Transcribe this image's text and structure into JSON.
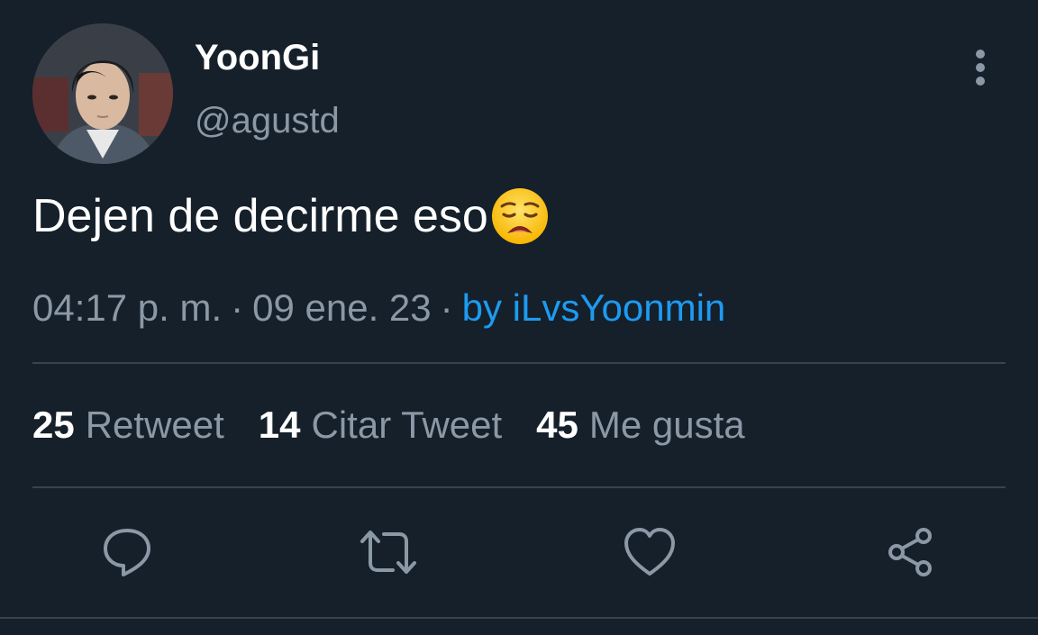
{
  "tweet": {
    "display_name": "YoonGi",
    "handle": "@agustd",
    "text": "Dejen de decirme eso",
    "emoji": "weary-face",
    "time": "04:17 p. m.",
    "separator": "·",
    "date": "09 ene. 23",
    "source": "by iLvsYoonmin"
  },
  "stats": [
    {
      "count": "25",
      "label": "Retweet"
    },
    {
      "count": "14",
      "label": "Citar Tweet"
    },
    {
      "count": "45",
      "label": "Me gusta"
    }
  ],
  "actions": [
    "reply-icon",
    "retweet-icon",
    "like-icon",
    "share-icon"
  ],
  "colors": {
    "background": "#15202b",
    "text": "#ffffff",
    "secondary": "#8b98a5",
    "link": "#1d9bf0",
    "divider": "#38444d"
  }
}
